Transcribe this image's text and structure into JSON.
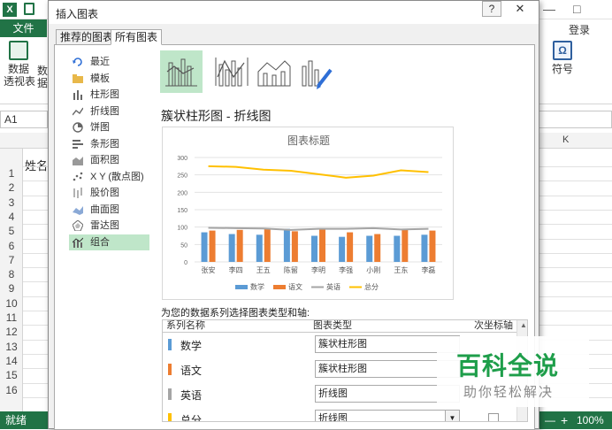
{
  "excel": {
    "file_tab": "文件",
    "login": "登录",
    "name_box": "A1",
    "ribbon_left_label": "数据\n透视表",
    "ribbon_left_label2": "数据",
    "ribbon_right_label": "符号",
    "column_k": "K",
    "cell_a1": "姓名",
    "row_numbers": [
      "1",
      "2",
      "3",
      "4",
      "5",
      "6",
      "7",
      "8",
      "9",
      "10",
      "11",
      "12",
      "13",
      "14",
      "15",
      "16"
    ],
    "status_left": "就绪",
    "zoom": "100%",
    "colors": {
      "accent": "#217346"
    }
  },
  "dialog": {
    "title": "插入图表",
    "help": "?",
    "tabs": [
      {
        "label": "推荐的图表",
        "active": false
      },
      {
        "label": "所有图表",
        "active": true
      }
    ],
    "categories": [
      {
        "label": "最近",
        "icon": "recent-icon"
      },
      {
        "label": "模板",
        "icon": "folder-icon"
      },
      {
        "label": "柱形图",
        "icon": "column-chart-icon"
      },
      {
        "label": "折线图",
        "icon": "line-chart-icon"
      },
      {
        "label": "饼图",
        "icon": "pie-chart-icon"
      },
      {
        "label": "条形图",
        "icon": "bar-chart-icon"
      },
      {
        "label": "面积图",
        "icon": "area-chart-icon"
      },
      {
        "label": "X Y (散点图)",
        "icon": "scatter-chart-icon"
      },
      {
        "label": "股价图",
        "icon": "stock-chart-icon"
      },
      {
        "label": "曲面图",
        "icon": "surface-chart-icon"
      },
      {
        "label": "雷达图",
        "icon": "radar-chart-icon"
      },
      {
        "label": "组合",
        "icon": "combo-chart-icon",
        "selected": true
      }
    ],
    "subtype_title": "簇状柱形图 - 折线图",
    "instruction": "为您的数据系列选择图表类型和轴:",
    "table_headers": {
      "name": "系列名称",
      "type": "图表类型",
      "secondary": "次坐标轴"
    },
    "series_rows": [
      {
        "name": "数学",
        "type": "簇状柱形图",
        "color": "#5b9bd5"
      },
      {
        "name": "语文",
        "type": "簇状柱形图",
        "color": "#ed7d31"
      },
      {
        "name": "英语",
        "type": "折线图",
        "color": "#a5a5a5"
      },
      {
        "name": "总分",
        "type": "折线图",
        "color": "#ffc000"
      }
    ]
  },
  "watermark": {
    "main": "百科全说",
    "sub": "助你轻松解决"
  },
  "chart_data": {
    "type": "bar",
    "title": "图表标题",
    "categories": [
      "张安",
      "李四",
      "王五",
      "陈留",
      "李明",
      "李强",
      "小刚",
      "王东",
      "李磊"
    ],
    "ylim": [
      0,
      300
    ],
    "yticks": [
      0,
      50,
      100,
      150,
      200,
      250,
      300
    ],
    "grid": true,
    "legend": "bottom",
    "series": [
      {
        "name": "数学",
        "kind": "bar",
        "color": "#5b9bd5",
        "values": [
          85,
          80,
          78,
          95,
          75,
          72,
          75,
          75,
          78
        ]
      },
      {
        "name": "语文",
        "kind": "bar",
        "color": "#ed7d31",
        "values": [
          90,
          92,
          94,
          88,
          95,
          85,
          80,
          95,
          90
        ]
      },
      {
        "name": "英语",
        "kind": "line",
        "color": "#a5a5a5",
        "values": [
          98,
          97,
          96,
          92,
          95,
          95,
          97,
          93,
          95
        ]
      },
      {
        "name": "总分",
        "kind": "line",
        "color": "#ffc000",
        "values": [
          275,
          273,
          265,
          262,
          252,
          242,
          248,
          263,
          258
        ]
      }
    ]
  }
}
